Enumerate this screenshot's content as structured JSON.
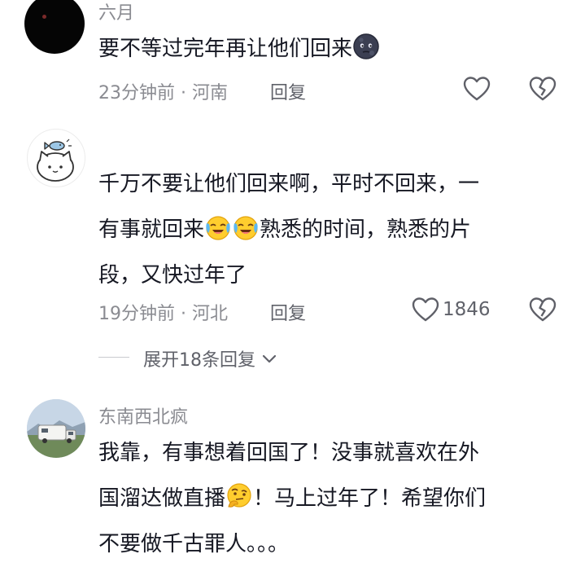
{
  "comments": [
    {
      "username": "六月",
      "line1": "要不等过完年再让他们回来",
      "time_location": "23分钟前 · 河南",
      "reply_label": "回复"
    },
    {
      "username": "",
      "line1": "千万不要让他们回来啊，平时不回来，一",
      "line2_a": "有事就回来",
      "line2_b": "熟悉的时间，熟悉的片",
      "line3": "段，又快过年了",
      "time_location": "19分钟前 · 河北",
      "reply_label": "回复",
      "like_count": "1846",
      "expand_label": "展开18条回复"
    },
    {
      "username": "东南西北疯",
      "line1": "我靠，有事想着回国了！没事就喜欢在外",
      "line2_a": "国溜达做直播",
      "line2_b": "！马上过年了！希望你们",
      "line3": "不要做千古罪人。。。"
    }
  ],
  "icons": {
    "like": "heart-outline-icon",
    "dislike": "broken-heart-icon",
    "expand": "chevron-down-icon",
    "emoji1": "dark-moon-face-emoji",
    "emoji2": "crying-laughing-face-emoji",
    "emoji3": "thinking-face-emoji"
  },
  "colors": {
    "text": "#161823",
    "meta": "#8a8b91",
    "reply": "#60626a",
    "icon": "#5f6068"
  }
}
